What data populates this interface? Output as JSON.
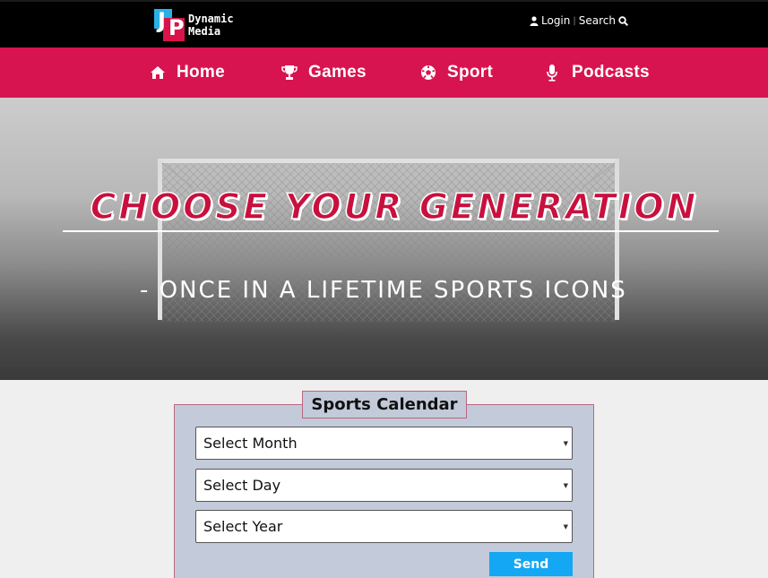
{
  "header": {
    "logo": {
      "line1": "Dynamic",
      "line2": "Media"
    },
    "login_label": "Login",
    "separator": "|",
    "search_label": "Search"
  },
  "nav": {
    "items": [
      {
        "label": "Home",
        "icon": "home-icon"
      },
      {
        "label": "Games",
        "icon": "trophy-icon"
      },
      {
        "label": "Sport",
        "icon": "soccer-ball-icon"
      },
      {
        "label": "Podcasts",
        "icon": "microphone-icon"
      }
    ]
  },
  "hero": {
    "title": "CHOOSE YOUR GENERATION",
    "subtitle": "- ONCE IN A LIFETIME SPORTS ICONS"
  },
  "calendar": {
    "legend": "Sports Calendar",
    "month_placeholder": "Select Month",
    "day_placeholder": "Select Day",
    "year_placeholder": "Select Year",
    "send_label": "Send"
  },
  "colors": {
    "nav_bg": "#d81450",
    "topbar_bg": "#000000",
    "form_bg": "#c3cad9",
    "send_bg": "#14a7f3",
    "title_red": "#c8103e"
  }
}
